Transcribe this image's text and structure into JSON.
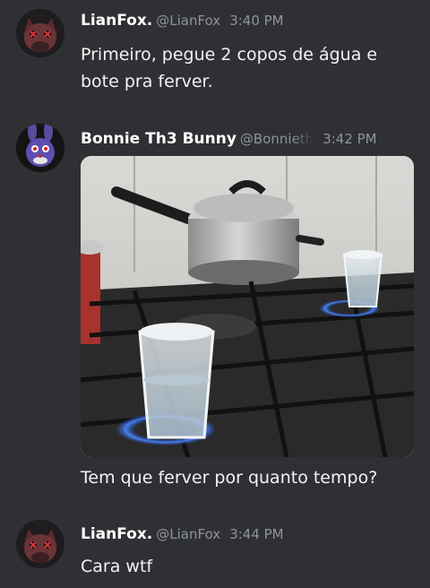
{
  "tweets": [
    {
      "name": "LianFox.",
      "handle": "@LianFox",
      "time": "3:40 PM",
      "text_lines": [
        "Primeiro, pegue 2 copos de água e",
        "bote pra ferver."
      ],
      "avatar_icon": "red-fox-animatronic-avatar"
    },
    {
      "name": "Bonnie Th3 Bunny",
      "handle": "@Bonnieth",
      "time": "3:42 PM",
      "text": "Tem que ferver por quanto tempo?",
      "avatar_icon": "purple-bunny-animatronic-avatar",
      "photo_icon": "stove-with-water-glasses-photo"
    },
    {
      "name": "LianFox.",
      "handle": "@LianFox",
      "time": "3:44 PM",
      "text": "Cara wtf",
      "avatar_icon": "red-fox-animatronic-avatar"
    }
  ],
  "colors": {
    "background": "#2f3034",
    "meta_text": "#8f949a",
    "body_text": "#f3f3f3"
  }
}
